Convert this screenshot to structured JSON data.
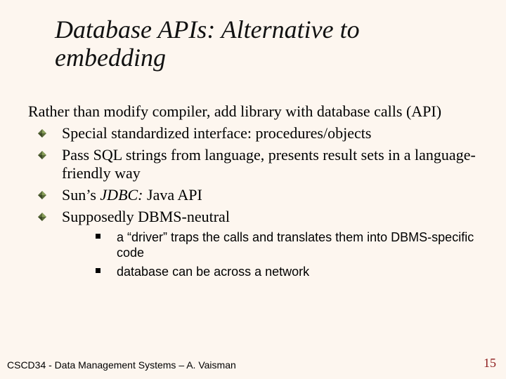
{
  "title": "Database APIs: Alternative to embedding",
  "intro": "Rather than modify compiler, add library with database calls (API)",
  "bullets": [
    {
      "text": "Special standardized interface: procedures/objects"
    },
    {
      "text": "Pass SQL strings from language, presents result sets in a language-friendly way"
    },
    {
      "html_parts": {
        "prefix": "Sun’s ",
        "em": "JDBC:",
        "suffix": " Java API"
      }
    },
    {
      "text": "Supposedly DBMS-neutral",
      "sub": [
        "a “driver” traps the calls and translates them into DBMS-specific code",
        "database can be across a network"
      ]
    }
  ],
  "footer": {
    "left": "CSCD34 - Data Management Systems – A. Vaisman",
    "right": "15"
  }
}
